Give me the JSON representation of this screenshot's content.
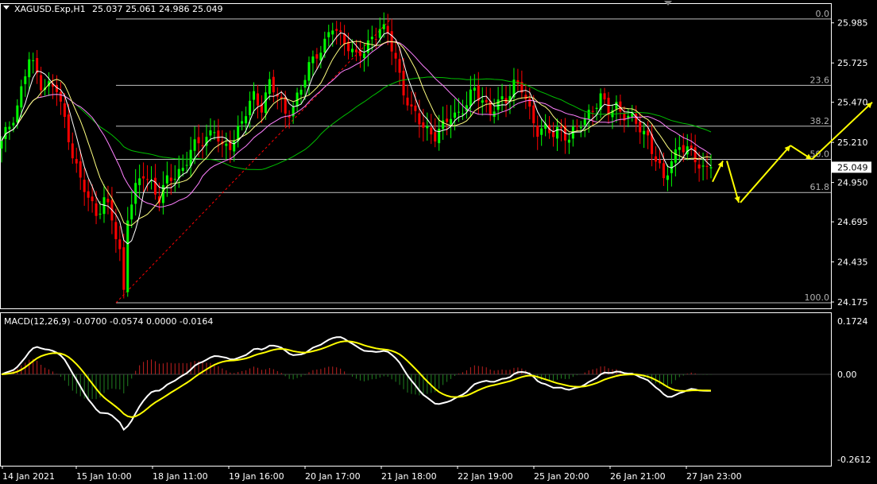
{
  "header": {
    "symbol_label": "XAGUSD.Exp,H1",
    "ohlc": "25.037 25.061 24.986 25.049"
  },
  "macd": {
    "label": "MACD(12,26,9) -0.0700 -0.0574 0.0000 -0.0164",
    "axis_labels": [
      "0.1724",
      "0.00",
      "-0.2612"
    ]
  },
  "colors": {
    "background": "#000000",
    "bull": "#00ff00",
    "bear": "#ff0000",
    "grid": "#c0c0c0",
    "macd_line": "#ffffff",
    "signal_line": "#ffff00",
    "ma_slow": "#00c000",
    "ma_mid": "#ff80ff",
    "ma_fast": "#ffff80",
    "ma_fastest": "#ffffff",
    "projection": "#ffff00"
  },
  "chart_data": {
    "type": "candlestick",
    "price_axis": [
      "25.985",
      "25.725",
      "25.470",
      "25.210",
      "24.950",
      "24.695",
      "24.435",
      "24.175"
    ],
    "current_price_label": "25.049",
    "time_axis": [
      "14 Jan 2021",
      "15 Jan 10:00",
      "18 Jan 11:00",
      "19 Jan 16:00",
      "20 Jan 17:00",
      "21 Jan 18:00",
      "22 Jan 19:00",
      "25 Jan 20:00",
      "26 Jan 21:00",
      "27 Jan 23:00"
    ],
    "ylim": [
      24.17,
      26.03
    ],
    "fibonacci": {
      "levels": [
        {
          "label": "0.0",
          "price": 26.01
        },
        {
          "label": "23.6",
          "price": 25.58
        },
        {
          "label": "38.2",
          "price": 25.315
        },
        {
          "label": "50.0",
          "price": 25.1
        },
        {
          "label": "61.8",
          "price": 24.885
        },
        {
          "label": "100.0",
          "price": 24.17
        }
      ]
    },
    "price_path": [
      [
        0,
        25.2
      ],
      [
        4,
        25.45
      ],
      [
        7,
        25.75
      ],
      [
        10,
        25.6
      ],
      [
        14,
        25.55
      ],
      [
        16,
        25.35
      ],
      [
        18,
        25.15
      ],
      [
        20,
        24.95
      ],
      [
        22,
        24.85
      ],
      [
        24,
        24.75
      ],
      [
        26,
        24.85
      ],
      [
        28,
        24.7
      ],
      [
        30,
        24.5
      ],
      [
        31,
        24.25
      ],
      [
        32,
        24.75
      ],
      [
        34,
        24.9
      ],
      [
        36,
        25.0
      ],
      [
        38,
        24.95
      ],
      [
        40,
        24.85
      ],
      [
        42,
        24.95
      ],
      [
        44,
        25.0
      ],
      [
        46,
        25.05
      ],
      [
        48,
        25.15
      ],
      [
        50,
        25.2
      ],
      [
        52,
        25.25
      ],
      [
        54,
        25.3
      ],
      [
        56,
        25.15
      ],
      [
        58,
        25.2
      ],
      [
        60,
        25.3
      ],
      [
        62,
        25.4
      ],
      [
        64,
        25.5
      ],
      [
        66,
        25.45
      ],
      [
        68,
        25.6
      ],
      [
        70,
        25.5
      ],
      [
        72,
        25.4
      ],
      [
        74,
        25.45
      ],
      [
        76,
        25.55
      ],
      [
        78,
        25.7
      ],
      [
        80,
        25.8
      ],
      [
        82,
        25.85
      ],
      [
        84,
        25.95
      ],
      [
        86,
        25.9
      ],
      [
        88,
        25.85
      ],
      [
        90,
        25.75
      ],
      [
        92,
        25.8
      ],
      [
        94,
        25.9
      ],
      [
        96,
        25.95
      ],
      [
        98,
        25.9
      ],
      [
        100,
        25.75
      ],
      [
        102,
        25.55
      ],
      [
        104,
        25.4
      ],
      [
        106,
        25.35
      ],
      [
        108,
        25.3
      ],
      [
        110,
        25.25
      ],
      [
        112,
        25.3
      ],
      [
        114,
        25.4
      ],
      [
        116,
        25.4
      ],
      [
        118,
        25.45
      ],
      [
        120,
        25.55
      ],
      [
        122,
        25.5
      ],
      [
        124,
        25.4
      ],
      [
        126,
        25.45
      ],
      [
        128,
        25.5
      ],
      [
        130,
        25.6
      ],
      [
        132,
        25.55
      ],
      [
        134,
        25.4
      ],
      [
        136,
        25.3
      ],
      [
        138,
        25.3
      ],
      [
        140,
        25.25
      ],
      [
        142,
        25.3
      ],
      [
        144,
        25.25
      ],
      [
        146,
        25.3
      ],
      [
        148,
        25.35
      ],
      [
        150,
        25.45
      ],
      [
        152,
        25.5
      ],
      [
        154,
        25.4
      ],
      [
        156,
        25.45
      ],
      [
        158,
        25.4
      ],
      [
        160,
        25.35
      ],
      [
        162,
        25.3
      ],
      [
        164,
        25.25
      ],
      [
        166,
        25.1
      ],
      [
        168,
        24.95
      ],
      [
        170,
        25.1
      ],
      [
        172,
        25.2
      ],
      [
        174,
        25.15
      ],
      [
        176,
        25.1
      ],
      [
        178,
        25.05
      ],
      [
        180,
        25.049
      ]
    ],
    "projection_path": [
      [
        24.955,
        25.09
      ],
      [
        25.09,
        24.82
      ],
      [
        24.82,
        25.19
      ],
      [
        25.19,
        25.1
      ],
      [
        25.1,
        25.47
      ]
    ]
  }
}
